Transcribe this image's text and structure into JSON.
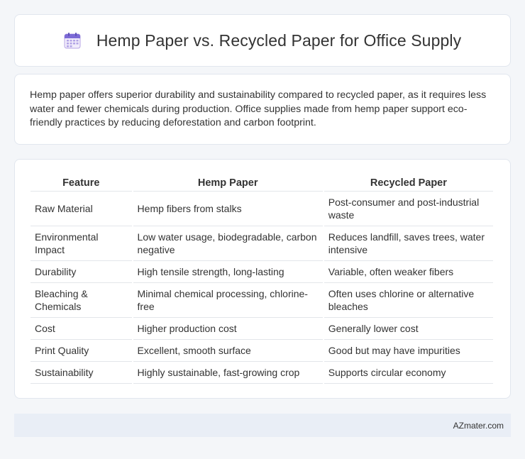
{
  "header": {
    "title": "Hemp Paper vs. Recycled Paper for Office Supply",
    "icon": "calendar-icon"
  },
  "intro": {
    "text": "Hemp paper offers superior durability and sustainability compared to recycled paper, as it requires less water and fewer chemicals during production. Office supplies made from hemp paper support eco-friendly practices by reducing deforestation and carbon footprint."
  },
  "table": {
    "headers": [
      "Feature",
      "Hemp Paper",
      "Recycled Paper"
    ],
    "rows": [
      [
        "Raw Material",
        "Hemp fibers from stalks",
        "Post-consumer and post-industrial waste"
      ],
      [
        "Environmental Impact",
        "Low water usage, biodegradable, carbon negative",
        "Reduces landfill, saves trees, water intensive"
      ],
      [
        "Durability",
        "High tensile strength, long-lasting",
        "Variable, often weaker fibers"
      ],
      [
        "Bleaching & Chemicals",
        "Minimal chemical processing, chlorine-free",
        "Often uses chlorine or alternative bleaches"
      ],
      [
        "Cost",
        "Higher production cost",
        "Generally lower cost"
      ],
      [
        "Print Quality",
        "Excellent, smooth surface",
        "Good but may have impurities"
      ],
      [
        "Sustainability",
        "Highly sustainable, fast-growing crop",
        "Supports circular economy"
      ]
    ]
  },
  "footer": {
    "text": "AZmater.com"
  }
}
